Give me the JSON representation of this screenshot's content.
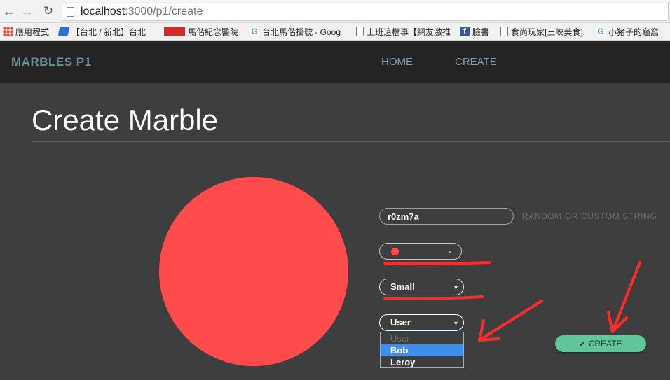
{
  "browser": {
    "back": "←",
    "forward": "→",
    "reload": "↻",
    "url_host": "localhost",
    "url_rest": ":3000/p1/create",
    "bookmarks": [
      {
        "label": "應用程式",
        "icon": "apps-grid-icon"
      },
      {
        "label": "【台北 / 新北】台北",
        "icon": "blue-bookmark-icon"
      },
      {
        "label": "馬偕紀念醫院",
        "icon": "hospital-logo-icon"
      },
      {
        "label": "台北馬偕掛號 - Goog",
        "icon": "google-icon"
      },
      {
        "label": "上班這檔事【網友激推",
        "icon": "page-icon"
      },
      {
        "label": "臉書",
        "icon": "facebook-icon"
      },
      {
        "label": "食尚玩家[三峽美食]",
        "icon": "page-icon"
      },
      {
        "label": "小猪子的龜窩",
        "icon": "google-icon"
      }
    ]
  },
  "header": {
    "brand": "MARBLES P1",
    "nav": {
      "home": "HOME",
      "create": "CREATE"
    }
  },
  "main": {
    "title": "Create Marble",
    "marble_color": "#ff4b4b",
    "name_input": {
      "value": "r0zm7a"
    },
    "name_hint": "RANDOM OR CUSTOM STRING",
    "color_select": {
      "value": "red",
      "dot_color": "#ff4b4b"
    },
    "size_select": {
      "value": "Small"
    },
    "user_select": {
      "value": "User",
      "options": [
        "User",
        "Bob",
        "Leroy"
      ],
      "highlighted": "Bob"
    },
    "create_button": {
      "icon": "✔",
      "label": "CREATE",
      "color": "#5fc79a"
    }
  },
  "chevron": "▾"
}
